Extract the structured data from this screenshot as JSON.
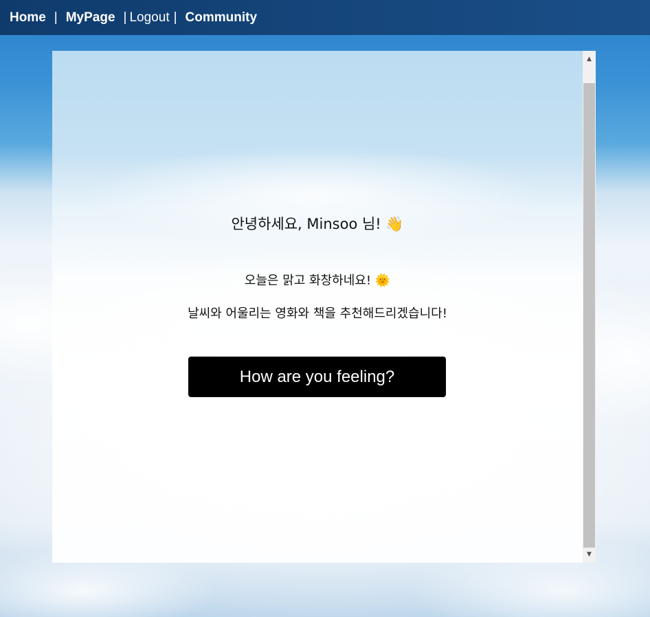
{
  "nav": {
    "home": "Home",
    "sep1": "|",
    "mypage": "MyPage",
    "sep2": "|",
    "logout": "Logout",
    "sep3": "|",
    "community": "Community"
  },
  "main": {
    "greeting": "안녕하세요, Minsoo 님! 👋",
    "weather": "오늘은 맑고 화창하네요! 🌞",
    "recommendation": "날씨와 어울리는 영화와 책을 추천해드리겠습니다!",
    "feeling_button": "How are you feeling?"
  },
  "scrollbar": {
    "up_arrow": "▲",
    "down_arrow": "▼"
  },
  "colors": {
    "nav_bg": "#13427a",
    "button_bg": "#000000",
    "button_text": "#ffffff",
    "scroll_thumb": "#c1c1c1"
  },
  "icons": {
    "wave": "waving-hand-icon",
    "sun": "sun-icon",
    "scroll_up": "scroll-up-arrow-icon",
    "scroll_down": "scroll-down-arrow-icon"
  }
}
